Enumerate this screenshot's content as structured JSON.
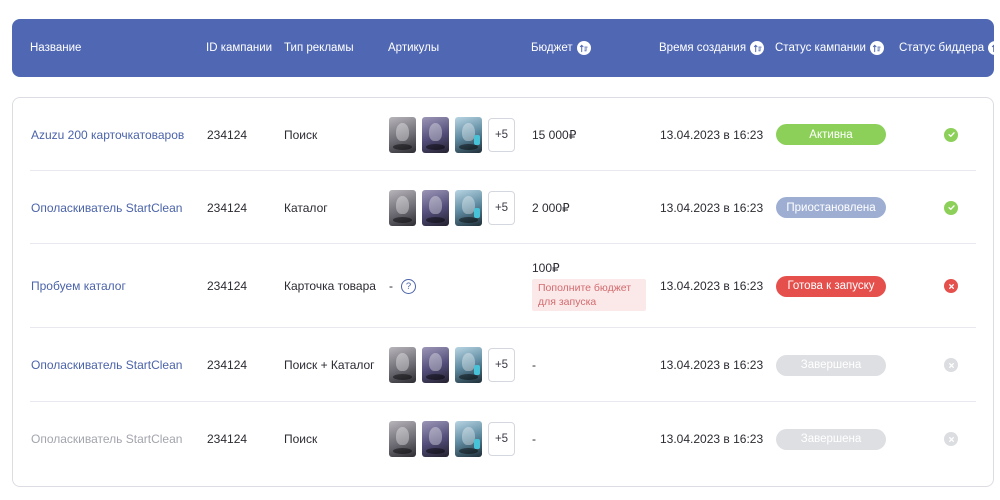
{
  "header": {
    "columns": [
      {
        "key": "name",
        "label": "Название",
        "sortable": false
      },
      {
        "key": "id",
        "label": "ID кампании",
        "sortable": false
      },
      {
        "key": "type",
        "label": "Тип рекламы",
        "sortable": false
      },
      {
        "key": "articles",
        "label": "Артикулы",
        "sortable": false
      },
      {
        "key": "budget",
        "label": "Бюджет",
        "sortable": true
      },
      {
        "key": "created",
        "label": "Время создания",
        "sortable": true
      },
      {
        "key": "campaign_status",
        "label": "Статус кампании",
        "sortable": true
      },
      {
        "key": "bidder_status",
        "label": "Статус биддера",
        "sortable": true
      }
    ]
  },
  "colors": {
    "header_bg": "#5068b3",
    "link": "#4b63a9",
    "status_active": "#8cd05a",
    "status_paused": "#9eaed3",
    "status_ready": "#e5504d",
    "status_done": "#dedfe3",
    "bidder_ok": "#8cd05a",
    "bidder_error": "#e5504d",
    "bidder_off": "#dcdde1"
  },
  "rows": [
    {
      "name": "Azuzu 200 карточкатоваров",
      "id": "234124",
      "type": "Поиск",
      "articles_more": "+5",
      "budget": "15 000₽",
      "created": "13.04.2023 в 16:23",
      "campaign_status": "Активна",
      "bidder_status_icon": "check-circle-icon"
    },
    {
      "name": "Ополаскиватель StartClean",
      "id": "234124",
      "type": "Каталог",
      "articles_more": "+5",
      "budget": "2 000₽",
      "created": "13.04.2023 в 16:23",
      "campaign_status": "Приостановлена",
      "bidder_status_icon": "check-circle-icon"
    },
    {
      "name": "Пробуем каталог",
      "id": "234124",
      "type": "Карточка товара",
      "articles_text": "-",
      "budget": "100₽",
      "budget_warning": "Пополните бюджет для запуска",
      "created": "13.04.2023 в 16:23",
      "campaign_status": "Готова к запуску",
      "bidder_status_icon": "x-circle-icon"
    },
    {
      "name": "Ополаскиватель StartClean",
      "id": "234124",
      "type": "Поиск + Каталог",
      "articles_more": "+5",
      "budget": "-",
      "created": "13.04.2023 в 16:23",
      "campaign_status": "Завершена",
      "bidder_status_icon": "x-circle-icon"
    },
    {
      "name": "Ополаскиватель StartClean",
      "id": "234124",
      "type": "Поиск",
      "articles_more": "+5",
      "budget": "-",
      "created": "13.04.2023 в 16:23",
      "campaign_status": "Завершена",
      "bidder_status_icon": "x-circle-icon"
    }
  ]
}
